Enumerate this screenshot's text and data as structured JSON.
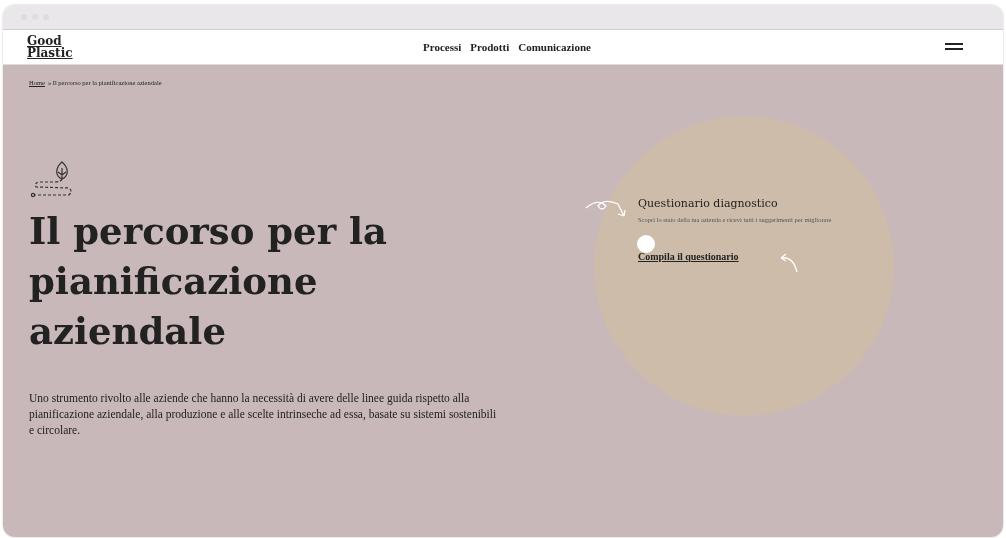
{
  "logo": {
    "lines": [
      "Good",
      "Plastic"
    ]
  },
  "nav": [
    {
      "label": "Processi"
    },
    {
      "label": "Prodotti"
    },
    {
      "label": "Comunicazione"
    }
  ],
  "breadcrumb": {
    "home": "Home",
    "separator": "»",
    "current": "Il percorso per la pianificazione aziendale"
  },
  "hero": {
    "title": "Il percorso per la pianificazione aziendale",
    "description": "Uno strumento rivolto alle aziende che hanno la necessità di avere delle linee guida rispetto alla pianificazione aziendale, alla produzione e alle scelte intrinseche ad essa, basate su sistemi sostenibili e circolare."
  },
  "card": {
    "title": "Questionario diagnostico",
    "text": "Scopri lo stato della tua azienda e ricevi tutti i suggerimenti per migliorare",
    "link": "Compila il questionario"
  }
}
